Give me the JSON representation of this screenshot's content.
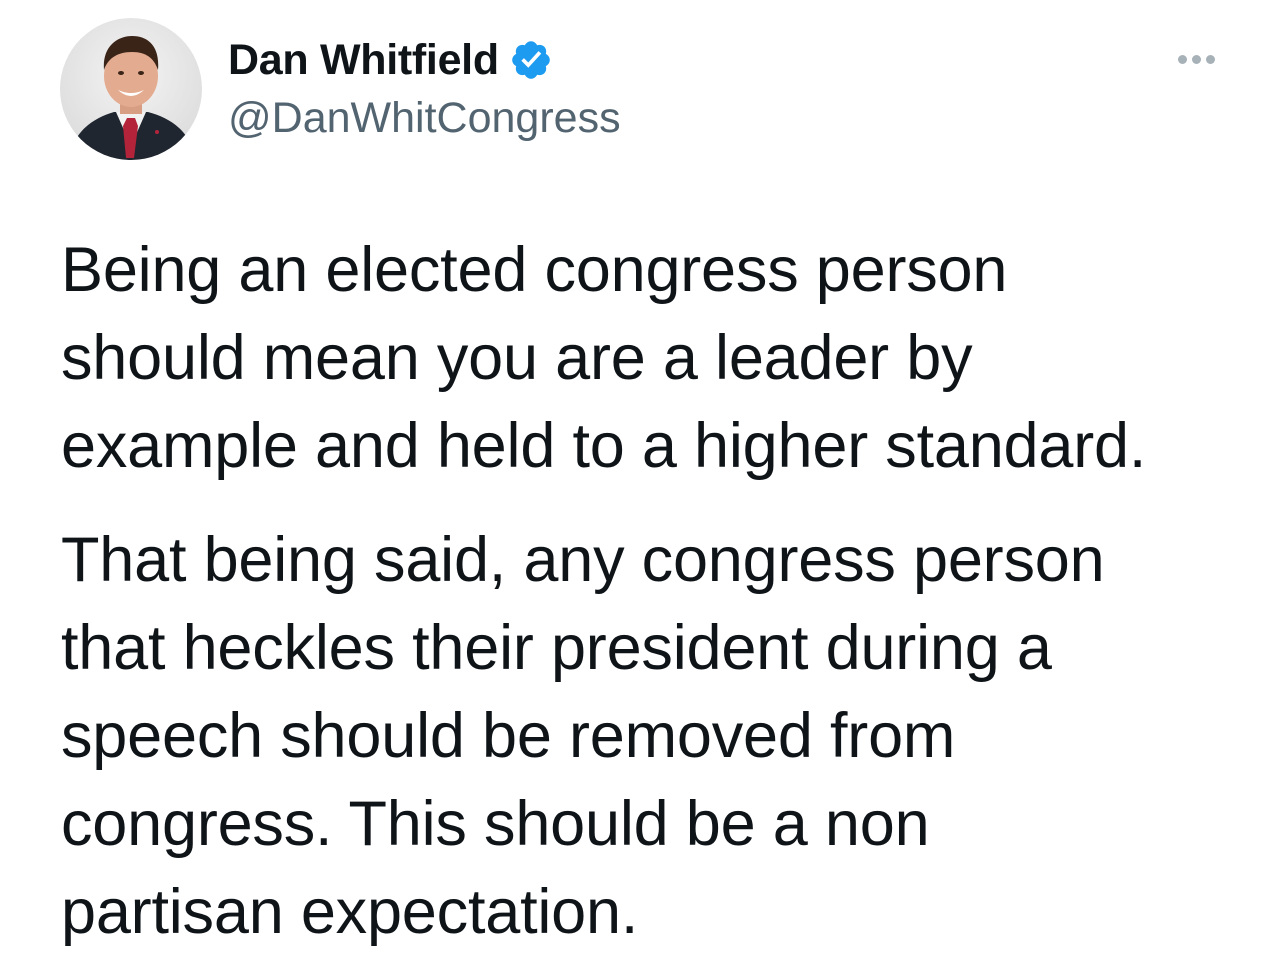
{
  "author": {
    "display_name": "Dan Whitfield",
    "handle": "@DanWhitCongress",
    "verified": true,
    "verified_color": "#1d9bf0",
    "avatar_icon": "profile-photo"
  },
  "more_menu": {
    "icon": "more-horizontal-icon"
  },
  "tweet": {
    "paragraphs": [
      {
        "lines": [
          "Being an elected congress person",
          "should mean you are a leader by",
          "example and held to a higher standard."
        ]
      },
      {
        "lines": [
          "That being said, any congress person",
          "that heckles their president during a",
          "speech should be removed from",
          "congress. This should be a non",
          "partisan expectation."
        ]
      }
    ]
  }
}
